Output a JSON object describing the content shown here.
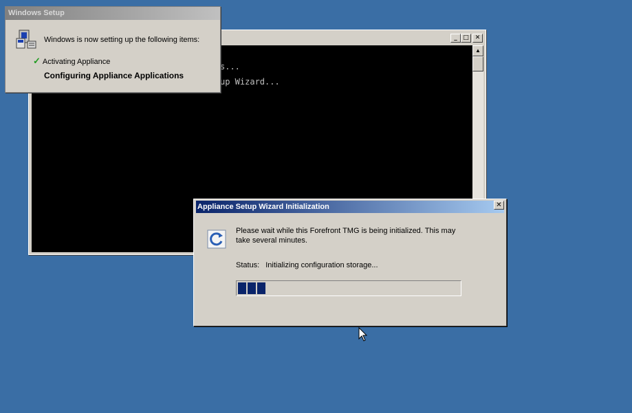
{
  "setup_window": {
    "title": "Windows Setup",
    "heading": "Windows is now setting up the following items:",
    "completed_item": "Activating Appliance",
    "current_item": "Configuring Appliance Applications"
  },
  "console_window": {
    "lines": [
      "s...",
      "up Wizard..."
    ],
    "buttons": {
      "minimize": "_",
      "maximize": "□",
      "close": "✕"
    }
  },
  "wizard_dialog": {
    "title": "Appliance Setup Wizard Initialization",
    "close_label": "✕",
    "message_line1": "Please wait while this Forefront TMG is being initialized. This may",
    "message_line2": "take several minutes.",
    "status_label": "Status:",
    "status_value": "Initializing configuration storage...",
    "progress_fraction": 0.13
  },
  "icons": {
    "setup": "computer-setup-icon",
    "wizard": "refresh-icon",
    "check": "checkmark-icon",
    "cursor": "mouse-pointer-icon"
  },
  "colors": {
    "desktop": "#3a6ea5",
    "active_title_start": "#0a246a",
    "active_title_end": "#a6caf0",
    "progress": "#0a246a",
    "check": "#1f9b1f"
  }
}
